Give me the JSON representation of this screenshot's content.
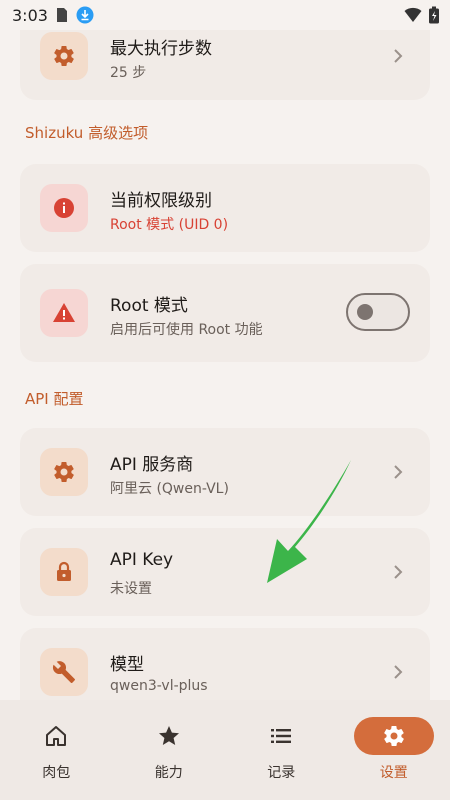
{
  "status": {
    "time": "3:03"
  },
  "settings": {
    "max_steps": {
      "title": "最大执行步数",
      "value": "25 步"
    },
    "shizuku_section": "Shizuku 高级选项",
    "permission_level": {
      "title": "当前权限级别",
      "value": "Root 模式 (UID 0)"
    },
    "root_mode": {
      "title": "Root 模式",
      "description": "启用后可使用 Root 功能",
      "enabled": false
    },
    "api_section": "API 配置",
    "api_provider": {
      "title": "API 服务商",
      "value": "阿里云 (Qwen-VL)"
    },
    "api_key": {
      "title": "API Key",
      "value": "未设置"
    },
    "model": {
      "title": "模型",
      "value": "qwen3-vl-plus"
    }
  },
  "nav": {
    "items": [
      {
        "label": "肉包",
        "icon": "home-icon"
      },
      {
        "label": "能力",
        "icon": "star-icon"
      },
      {
        "label": "记录",
        "icon": "list-icon"
      },
      {
        "label": "设置",
        "icon": "gear-icon"
      }
    ],
    "active_index": 3
  },
  "colors": {
    "accent": "#c25d2c",
    "accent_fill": "#d46d3c",
    "danger": "#d84234",
    "annotation_arrow": "#3cb54a"
  }
}
